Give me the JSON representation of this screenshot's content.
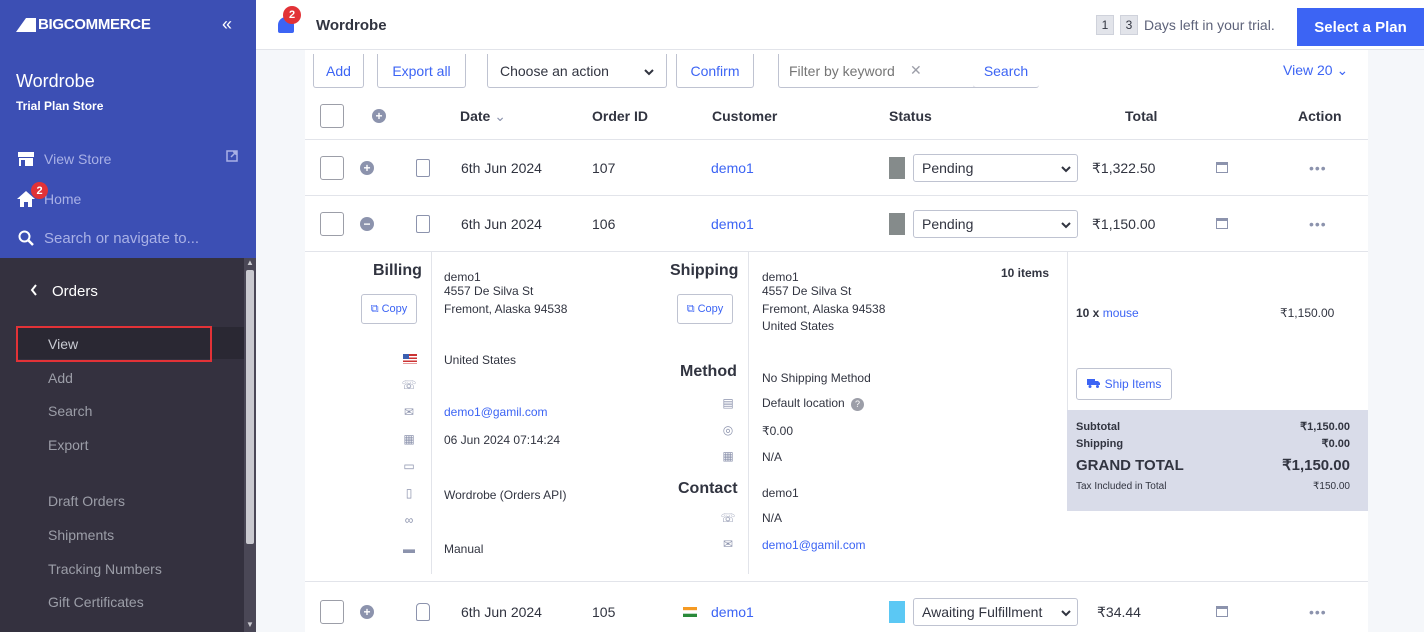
{
  "sidebar": {
    "brand": "BIGCOMMERCE",
    "collapse_glyph": "«",
    "store_name": "Wordrobe",
    "store_plan": "Trial Plan Store",
    "view_store": "View Store",
    "home": "Home",
    "home_badge": "2",
    "search_placeholder": "Search or navigate to...",
    "section": "Orders",
    "items": [
      "View",
      "Add",
      "Search",
      "Export",
      "Draft Orders",
      "Shipments",
      "Tracking Numbers",
      "Gift Certificates"
    ],
    "active_item": "View"
  },
  "header": {
    "notification_count": "2",
    "title": "Wordrobe",
    "trial_digits": [
      "1",
      "3"
    ],
    "trial_text": "Days left in your trial.",
    "plan_button": "Select a Plan"
  },
  "toolbar": {
    "add": "Add",
    "export_all": "Export all",
    "action_select": "Choose an action",
    "confirm": "Confirm",
    "filter_placeholder": "Filter by keyword",
    "search": "Search",
    "view": "View 20"
  },
  "table": {
    "headers": {
      "date": "Date",
      "order_id": "Order ID",
      "customer": "Customer",
      "status": "Status",
      "total": "Total",
      "action": "Action"
    },
    "rows": [
      {
        "date": "6th Jun 2024",
        "order_id": "107",
        "customer": "demo1",
        "status": "Pending",
        "status_color": "#858b8b",
        "total": "₹1,322.50"
      },
      {
        "date": "6th Jun 2024",
        "order_id": "106",
        "customer": "demo1",
        "status": "Pending",
        "status_color": "#858b8b",
        "total": "₹1,150.00"
      },
      {
        "date": "6th Jun 2024",
        "order_id": "105",
        "customer": "demo1",
        "status": "Awaiting Fulfillment",
        "status_color": "#5bc8f4",
        "total": "₹34.44"
      }
    ]
  },
  "details": {
    "billing": {
      "label": "Billing",
      "copy": "Copy",
      "name": "demo1",
      "street": "4557 De Silva St",
      "city": "Fremont, Alaska 94538",
      "country": "United States",
      "email": "demo1@gamil.com",
      "date": "06 Jun 2024 07:14:24",
      "channel": "Wordrobe (Orders API)",
      "payment": "Manual"
    },
    "shipping": {
      "label": "Shipping",
      "copy": "Copy",
      "name": "demo1",
      "street": "4557 De Silva St",
      "city": "Fremont, Alaska 94538",
      "country": "United States",
      "items_count": "10 items"
    },
    "method": {
      "label": "Method",
      "method": "No Shipping Method",
      "location": "Default location",
      "cost": "₹0.00",
      "date": "N/A"
    },
    "contact": {
      "label": "Contact",
      "name": "demo1",
      "phone": "N/A",
      "email": "demo1@gamil.com"
    },
    "line_item": {
      "qty": "10 x",
      "name": "mouse",
      "price": "₹1,150.00"
    },
    "ship_items": "Ship Items",
    "totals": {
      "subtotal_label": "Subtotal",
      "subtotal": "₹1,150.00",
      "shipping_label": "Shipping",
      "shipping": "₹0.00",
      "grand_label": "GRAND TOTAL",
      "grand": "₹1,150.00",
      "tax_label": "Tax Included in Total",
      "tax": "₹150.00"
    }
  },
  "colors": {
    "accent": "#3c64f4",
    "sidebar_top": "#3c4fb4",
    "sidebar": "#34313f",
    "badge": "#e23237"
  }
}
